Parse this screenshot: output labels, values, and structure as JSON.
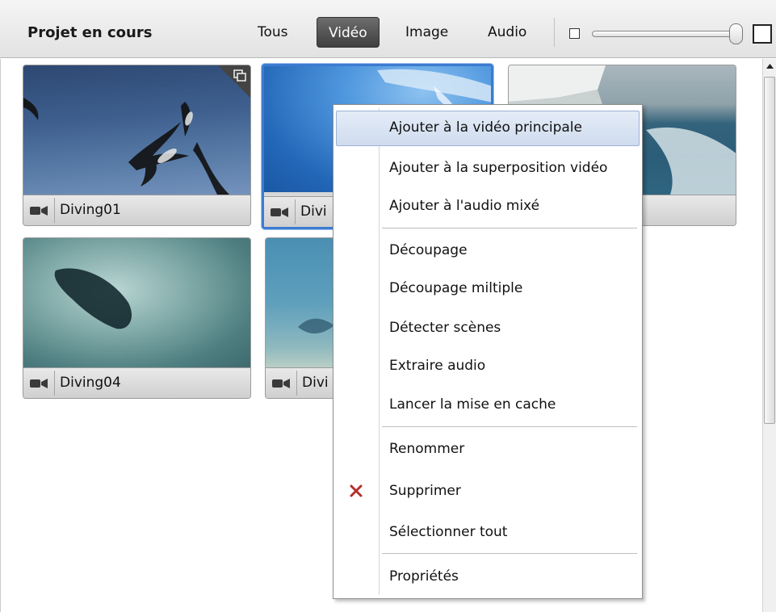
{
  "header": {
    "title": "Projet en cours",
    "filters": [
      "Tous",
      "Vidéo",
      "Image",
      "Audio"
    ],
    "active_filter": "Vidéo",
    "thumbnail_size_level": 1.0
  },
  "clips": [
    {
      "name": "Diving01",
      "type_icon": "video-camera-icon",
      "selected": false,
      "badge": "overlay-icon"
    },
    {
      "name": "Divi",
      "type_icon": "video-camera-icon",
      "selected": true
    },
    {
      "name": "",
      "type_icon": "video-camera-icon",
      "selected": false
    },
    {
      "name": "Diving04",
      "type_icon": "video-camera-icon",
      "selected": false
    },
    {
      "name": "Divi",
      "type_icon": "video-camera-icon",
      "selected": false
    }
  ],
  "context_menu": {
    "groups": [
      [
        "Ajouter à la vidéo principale",
        "Ajouter à la superposition vidéo",
        "Ajouter à l'audio mixé"
      ],
      [
        "Découpage",
        "Découpage miltiple",
        "Détecter scènes",
        "Extraire audio",
        "Lancer la mise en cache"
      ],
      [
        "Renommer",
        "Supprimer",
        "Sélectionner tout"
      ],
      [
        "Propriétés"
      ]
    ],
    "highlighted": "Ajouter à la vidéo principale",
    "delete_icon": "red-x-icon",
    "colors": {
      "highlight": "#cfdcee",
      "delete_icon": "#b3312c"
    }
  },
  "colors": {
    "selection": "#3c7cd0",
    "active_filter_bg": "#4a4a4a"
  }
}
